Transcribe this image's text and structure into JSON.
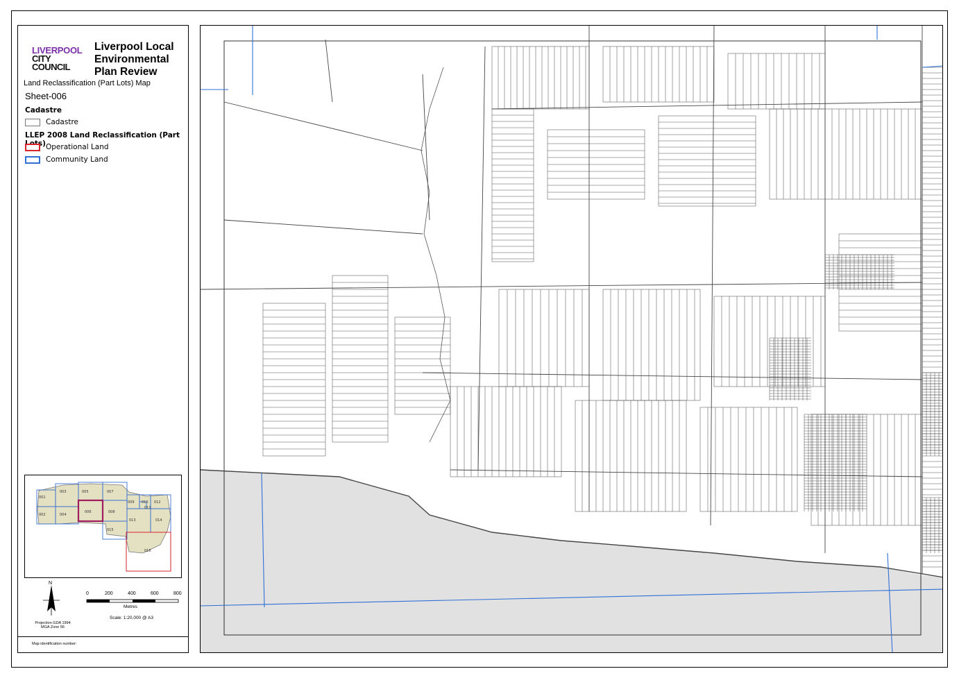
{
  "logo": {
    "line1": "LIVERPOOL",
    "line2": "CITY",
    "line3": "COUNCIL"
  },
  "title": "Liverpool Local Environmental Plan Review",
  "subtitle": "Land  Reclassification (Part Lots) Map",
  "sheet": "Sheet-006",
  "legend": {
    "cadastre_heading": "Cadastre",
    "cadastre_item": "Cadastre",
    "reclass_heading": "LLEP 2008 Land  Reclassification (Part Lots)",
    "operational": "Operational Land",
    "community": "Community Land"
  },
  "colors": {
    "operational": "#d6232a",
    "community": "#2f6fd6",
    "logo_purple": "#7b2fa8",
    "outside_area": "#e1e1e1",
    "keymap_fill": "#e3e1c2"
  },
  "keymap": {
    "sheets": [
      "001",
      "002",
      "003",
      "004",
      "005",
      "006",
      "007",
      "008",
      "009",
      "010",
      "011",
      "012",
      "013",
      "014",
      "015",
      "016"
    ],
    "current": "006"
  },
  "north": "N",
  "projection": "Projection GDA 1994 MGA Zone 56",
  "scale": {
    "ticks": [
      "0",
      "200",
      "400",
      "600",
      "800"
    ],
    "units": "Metres",
    "text": "Scale: 1:20,000 @ A3"
  },
  "map_id_label": "Map identification number:"
}
